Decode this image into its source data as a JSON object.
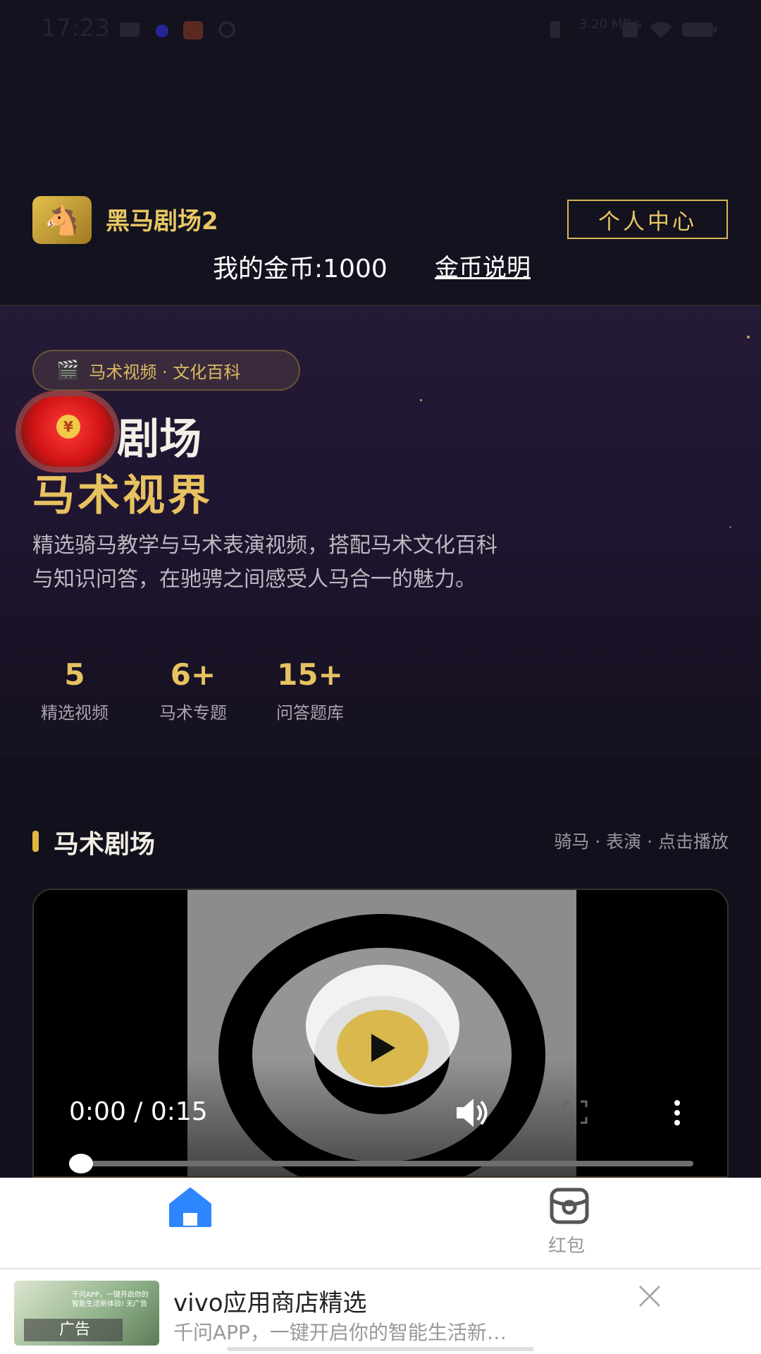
{
  "status": {
    "time": "17:23",
    "speed": "3.20 MB/s"
  },
  "header": {
    "app_title": "黑马剧场2",
    "user_center": "个人中心",
    "coins": "我的金币:1000",
    "coin_help": "金币说明"
  },
  "hero": {
    "tag": "马术视频 · 文化百科",
    "title_line1": "马剧场",
    "title_line2": "马术视界",
    "description": "精选骑马教学与马术表演视频，搭配马术文化百科与知识问答，在驰骋之间感受人马合一的魅力。",
    "stats": [
      {
        "value": "5",
        "label": "精选视频"
      },
      {
        "value": "6+",
        "label": "马术专题"
      },
      {
        "value": "15+",
        "label": "问答题库"
      }
    ]
  },
  "section": {
    "title": "马术剧场",
    "subtitle": "骑马 · 表演 · 点击播放"
  },
  "video": {
    "time": "0:00 / 0:15",
    "progress": 0
  },
  "nav": {
    "red_label": "红包"
  },
  "ad": {
    "title": "vivo应用商店精选",
    "desc": "千问APP，一键开启你的智能生活新…",
    "badge": "广告",
    "thumb_text": "千问APP，一键开启你的智能生活新体验! 无广告"
  },
  "colors": {
    "accent": "#e6c261",
    "background": "#11101c"
  }
}
